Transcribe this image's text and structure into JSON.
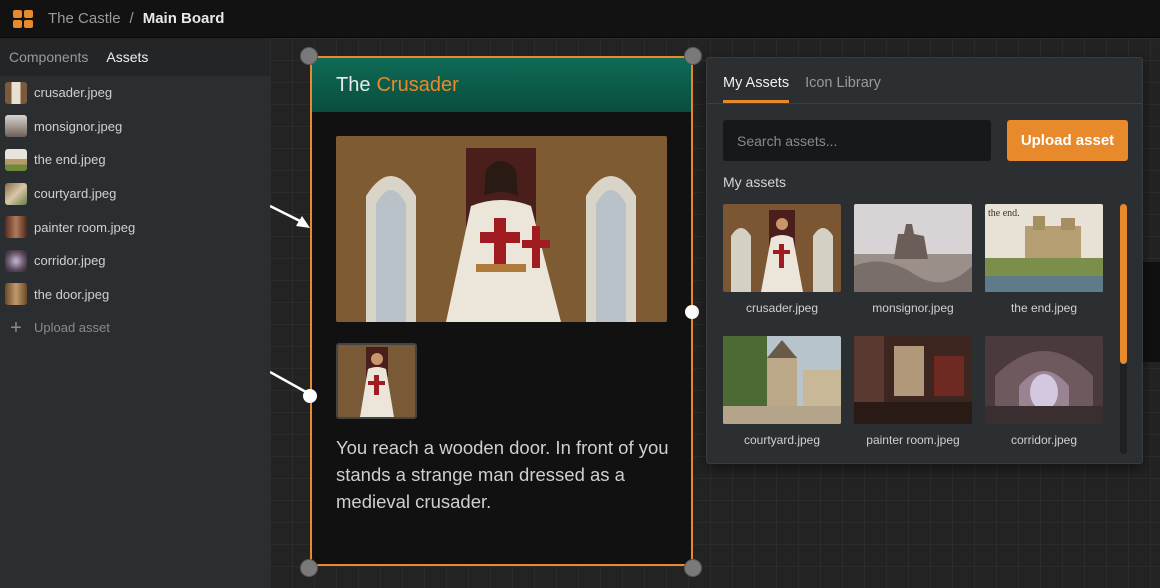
{
  "breadcrumb": {
    "project": "The Castle",
    "separator": "/",
    "board": "Main Board"
  },
  "sidebar": {
    "tabs": [
      {
        "label": "Components"
      },
      {
        "label": "Assets"
      }
    ],
    "items": [
      {
        "label": "crusader.jpeg"
      },
      {
        "label": "monsignor.jpeg"
      },
      {
        "label": "the end.jpeg"
      },
      {
        "label": "courtyard.jpeg"
      },
      {
        "label": "painter room.jpeg"
      },
      {
        "label": "corridor.jpeg"
      },
      {
        "label": "the door.jpeg"
      }
    ],
    "upload_label": "Upload asset"
  },
  "card": {
    "title_prefix": "The",
    "title_accent": "Crusader",
    "text": "You reach a wooden door. In front of you stands a strange man dressed as a medieval crusader."
  },
  "assets_popup": {
    "tabs": [
      {
        "label": "My Assets"
      },
      {
        "label": "Icon Library"
      }
    ],
    "search_placeholder": "Search assets...",
    "upload_button": "Upload asset",
    "section_label": "My assets",
    "tiles": [
      {
        "caption": "crusader.jpeg"
      },
      {
        "caption": "monsignor.jpeg"
      },
      {
        "caption": "the end.jpeg",
        "overlay": "the end."
      },
      {
        "caption": "courtyard.jpeg"
      },
      {
        "caption": "painter room.jpeg"
      },
      {
        "caption": "corridor.jpeg"
      }
    ]
  },
  "colors": {
    "accent": "#e8892b",
    "header_green": "#0e6b55",
    "panel": "#2c2f31"
  }
}
